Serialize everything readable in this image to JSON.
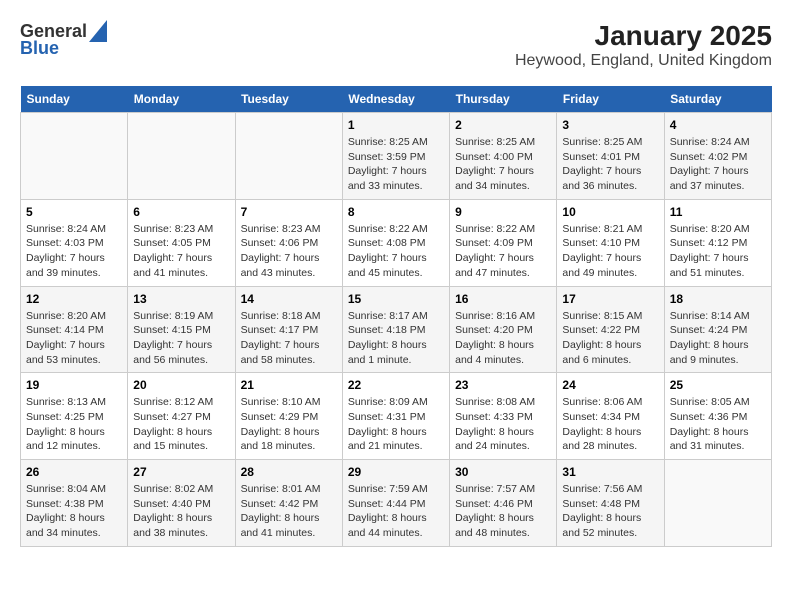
{
  "logo": {
    "line1": "General",
    "line2": "Blue"
  },
  "title": "January 2025",
  "subtitle": "Heywood, England, United Kingdom",
  "days_of_week": [
    "Sunday",
    "Monday",
    "Tuesday",
    "Wednesday",
    "Thursday",
    "Friday",
    "Saturday"
  ],
  "weeks": [
    [
      {
        "day": "",
        "details": []
      },
      {
        "day": "",
        "details": []
      },
      {
        "day": "",
        "details": []
      },
      {
        "day": "1",
        "details": [
          "Sunrise: 8:25 AM",
          "Sunset: 3:59 PM",
          "Daylight: 7 hours",
          "and 33 minutes."
        ]
      },
      {
        "day": "2",
        "details": [
          "Sunrise: 8:25 AM",
          "Sunset: 4:00 PM",
          "Daylight: 7 hours",
          "and 34 minutes."
        ]
      },
      {
        "day": "3",
        "details": [
          "Sunrise: 8:25 AM",
          "Sunset: 4:01 PM",
          "Daylight: 7 hours",
          "and 36 minutes."
        ]
      },
      {
        "day": "4",
        "details": [
          "Sunrise: 8:24 AM",
          "Sunset: 4:02 PM",
          "Daylight: 7 hours",
          "and 37 minutes."
        ]
      }
    ],
    [
      {
        "day": "5",
        "details": [
          "Sunrise: 8:24 AM",
          "Sunset: 4:03 PM",
          "Daylight: 7 hours",
          "and 39 minutes."
        ]
      },
      {
        "day": "6",
        "details": [
          "Sunrise: 8:23 AM",
          "Sunset: 4:05 PM",
          "Daylight: 7 hours",
          "and 41 minutes."
        ]
      },
      {
        "day": "7",
        "details": [
          "Sunrise: 8:23 AM",
          "Sunset: 4:06 PM",
          "Daylight: 7 hours",
          "and 43 minutes."
        ]
      },
      {
        "day": "8",
        "details": [
          "Sunrise: 8:22 AM",
          "Sunset: 4:08 PM",
          "Daylight: 7 hours",
          "and 45 minutes."
        ]
      },
      {
        "day": "9",
        "details": [
          "Sunrise: 8:22 AM",
          "Sunset: 4:09 PM",
          "Daylight: 7 hours",
          "and 47 minutes."
        ]
      },
      {
        "day": "10",
        "details": [
          "Sunrise: 8:21 AM",
          "Sunset: 4:10 PM",
          "Daylight: 7 hours",
          "and 49 minutes."
        ]
      },
      {
        "day": "11",
        "details": [
          "Sunrise: 8:20 AM",
          "Sunset: 4:12 PM",
          "Daylight: 7 hours",
          "and 51 minutes."
        ]
      }
    ],
    [
      {
        "day": "12",
        "details": [
          "Sunrise: 8:20 AM",
          "Sunset: 4:14 PM",
          "Daylight: 7 hours",
          "and 53 minutes."
        ]
      },
      {
        "day": "13",
        "details": [
          "Sunrise: 8:19 AM",
          "Sunset: 4:15 PM",
          "Daylight: 7 hours",
          "and 56 minutes."
        ]
      },
      {
        "day": "14",
        "details": [
          "Sunrise: 8:18 AM",
          "Sunset: 4:17 PM",
          "Daylight: 7 hours",
          "and 58 minutes."
        ]
      },
      {
        "day": "15",
        "details": [
          "Sunrise: 8:17 AM",
          "Sunset: 4:18 PM",
          "Daylight: 8 hours",
          "and 1 minute."
        ]
      },
      {
        "day": "16",
        "details": [
          "Sunrise: 8:16 AM",
          "Sunset: 4:20 PM",
          "Daylight: 8 hours",
          "and 4 minutes."
        ]
      },
      {
        "day": "17",
        "details": [
          "Sunrise: 8:15 AM",
          "Sunset: 4:22 PM",
          "Daylight: 8 hours",
          "and 6 minutes."
        ]
      },
      {
        "day": "18",
        "details": [
          "Sunrise: 8:14 AM",
          "Sunset: 4:24 PM",
          "Daylight: 8 hours",
          "and 9 minutes."
        ]
      }
    ],
    [
      {
        "day": "19",
        "details": [
          "Sunrise: 8:13 AM",
          "Sunset: 4:25 PM",
          "Daylight: 8 hours",
          "and 12 minutes."
        ]
      },
      {
        "day": "20",
        "details": [
          "Sunrise: 8:12 AM",
          "Sunset: 4:27 PM",
          "Daylight: 8 hours",
          "and 15 minutes."
        ]
      },
      {
        "day": "21",
        "details": [
          "Sunrise: 8:10 AM",
          "Sunset: 4:29 PM",
          "Daylight: 8 hours",
          "and 18 minutes."
        ]
      },
      {
        "day": "22",
        "details": [
          "Sunrise: 8:09 AM",
          "Sunset: 4:31 PM",
          "Daylight: 8 hours",
          "and 21 minutes."
        ]
      },
      {
        "day": "23",
        "details": [
          "Sunrise: 8:08 AM",
          "Sunset: 4:33 PM",
          "Daylight: 8 hours",
          "and 24 minutes."
        ]
      },
      {
        "day": "24",
        "details": [
          "Sunrise: 8:06 AM",
          "Sunset: 4:34 PM",
          "Daylight: 8 hours",
          "and 28 minutes."
        ]
      },
      {
        "day": "25",
        "details": [
          "Sunrise: 8:05 AM",
          "Sunset: 4:36 PM",
          "Daylight: 8 hours",
          "and 31 minutes."
        ]
      }
    ],
    [
      {
        "day": "26",
        "details": [
          "Sunrise: 8:04 AM",
          "Sunset: 4:38 PM",
          "Daylight: 8 hours",
          "and 34 minutes."
        ]
      },
      {
        "day": "27",
        "details": [
          "Sunrise: 8:02 AM",
          "Sunset: 4:40 PM",
          "Daylight: 8 hours",
          "and 38 minutes."
        ]
      },
      {
        "day": "28",
        "details": [
          "Sunrise: 8:01 AM",
          "Sunset: 4:42 PM",
          "Daylight: 8 hours",
          "and 41 minutes."
        ]
      },
      {
        "day": "29",
        "details": [
          "Sunrise: 7:59 AM",
          "Sunset: 4:44 PM",
          "Daylight: 8 hours",
          "and 44 minutes."
        ]
      },
      {
        "day": "30",
        "details": [
          "Sunrise: 7:57 AM",
          "Sunset: 4:46 PM",
          "Daylight: 8 hours",
          "and 48 minutes."
        ]
      },
      {
        "day": "31",
        "details": [
          "Sunrise: 7:56 AM",
          "Sunset: 4:48 PM",
          "Daylight: 8 hours",
          "and 52 minutes."
        ]
      },
      {
        "day": "",
        "details": []
      }
    ]
  ]
}
